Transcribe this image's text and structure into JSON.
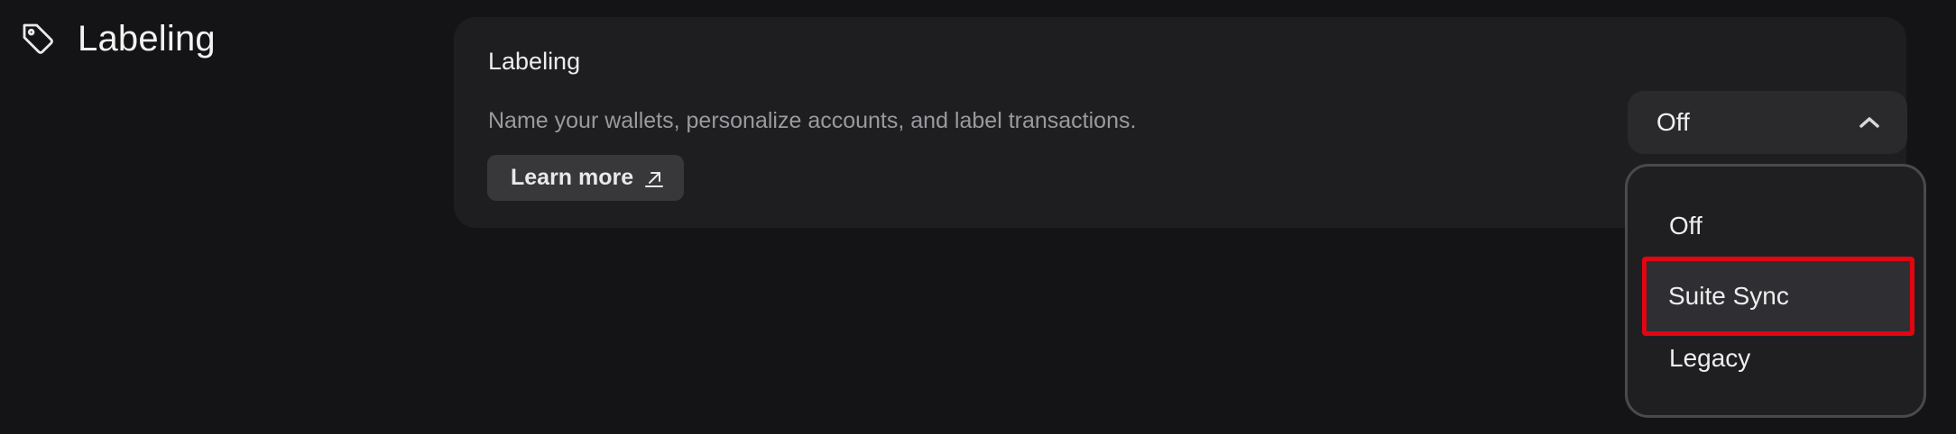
{
  "section": {
    "title": "Labeling",
    "icon": "tag-icon"
  },
  "card": {
    "title": "Labeling",
    "description": "Name your wallets, personalize accounts, and label transactions.",
    "learn_more_label": "Learn more",
    "learn_more_icon": "external-link-icon"
  },
  "select": {
    "value": "Off",
    "chevron_icon": "chevron-up-icon",
    "options": [
      {
        "label": "Off"
      },
      {
        "label": "Suite Sync",
        "highlighted": true
      },
      {
        "label": "Legacy"
      }
    ]
  },
  "colors": {
    "background": "#141416",
    "card": "#1e1e20",
    "button": "#38383b",
    "highlight_border": "#e00612"
  }
}
